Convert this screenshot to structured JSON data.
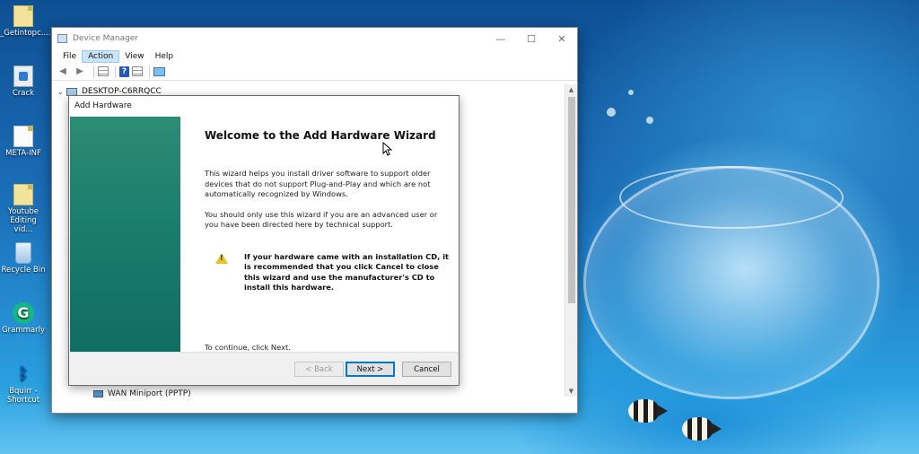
{
  "desktop": {
    "icons": [
      {
        "label": "_Getintopc....",
        "icon": "folder-file-icon"
      },
      {
        "label": "Crack",
        "icon": "crack-app-icon"
      },
      {
        "label": "META-INF",
        "icon": "file-icon"
      },
      {
        "label": "Youtube Editing vid...",
        "icon": "folder-file-icon"
      },
      {
        "label": "Recycle Bin",
        "icon": "recycle-bin-icon"
      },
      {
        "label": "Grammarly",
        "icon": "grammarly-icon"
      },
      {
        "label": "Bquirr - Shortcut",
        "icon": "bluetooth-icon"
      }
    ]
  },
  "device_manager": {
    "title": "Device Manager",
    "window_controls": {
      "minimize": "—",
      "maximize": "☐",
      "close": "✕"
    },
    "menu": [
      "File",
      "Action",
      "View",
      "Help"
    ],
    "active_menu": "Action",
    "toolbar_icons": [
      "back-arrow-icon",
      "forward-arrow-icon",
      "properties-icon",
      "help-icon",
      "show-hidden-icon",
      "monitor-icon"
    ],
    "tree_root": "DESKTOP-C6RRQCC",
    "tree_items": [
      "WAN Miniport (PPTP)"
    ]
  },
  "wizard": {
    "title": "Add Hardware",
    "heading": "Welcome to the Add Hardware Wizard",
    "paragraph1": "This wizard helps you install driver software to support older devices that do not support Plug-and-Play and which are not automatically recognized by Windows.",
    "paragraph2": "You should only use this wizard if you are an advanced user or you have been directed here by technical support.",
    "warning": "If your hardware came with an installation CD, it is recommended that you click Cancel to close this wizard and use the manufacturer's CD to install this hardware.",
    "continue_text": "To continue, click Next.",
    "buttons": {
      "back": "< Back",
      "next": "Next >",
      "cancel": "Cancel"
    },
    "accent_color": "#1b7d6c"
  }
}
